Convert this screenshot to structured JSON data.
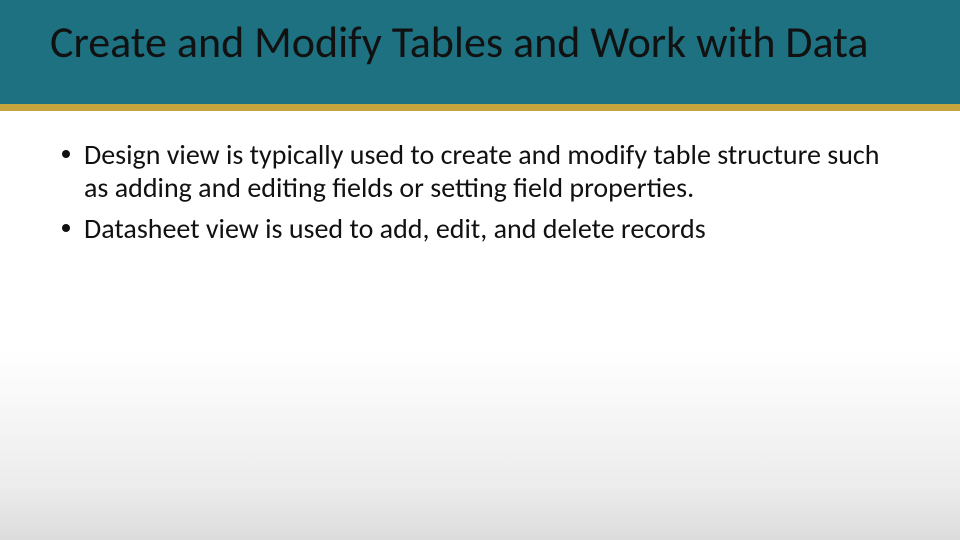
{
  "slide": {
    "title": "Create and Modify Tables and Work with Data",
    "bullets": [
      "Design view is typically used to create and modify table structure such as adding and editing fields or setting field properties.",
      "Datasheet view is used to add, edit, and delete records"
    ],
    "colors": {
      "header": "#1d7181",
      "accent": "#c6a53f",
      "text": "#111111"
    }
  }
}
